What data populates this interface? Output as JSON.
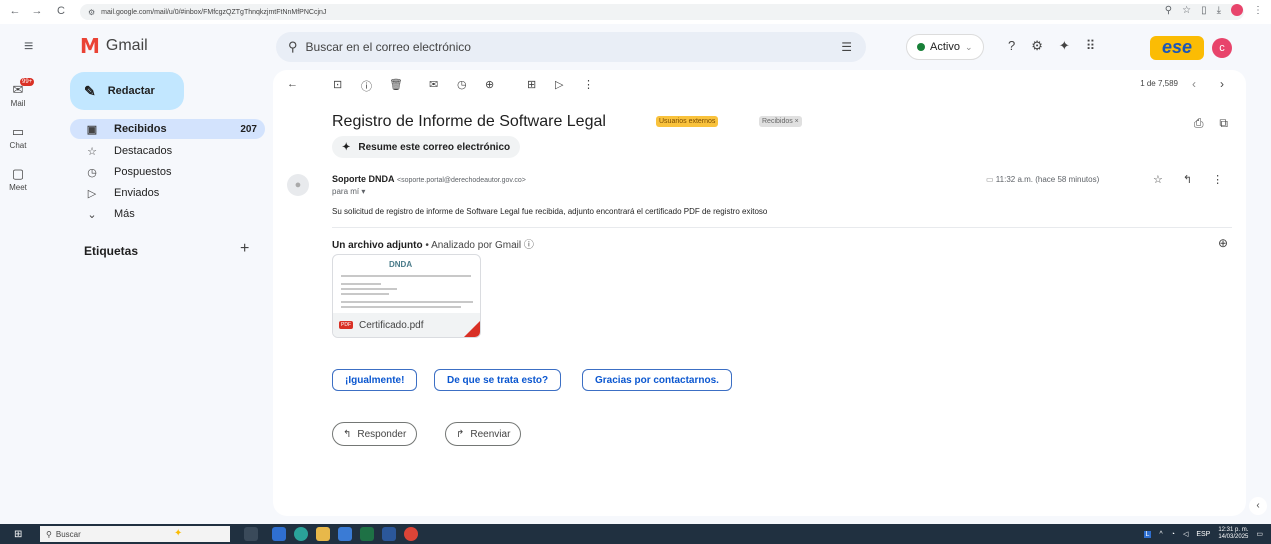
{
  "browser": {
    "url": "mail.google.com/mail/u/0/#inbox/FMfcgzQZTgThnqkzjmtFtNnMfPNCcjnJ",
    "nav": {
      "back": "←",
      "forward": "→",
      "reload": "C"
    },
    "right_icons": [
      "⚲",
      "☆",
      "▯",
      "⤓"
    ]
  },
  "header": {
    "app_name": "Gmail",
    "search_placeholder": "Buscar en el correo electrónico",
    "status_label": "Activo",
    "brand_text": "ese",
    "avatar_initial": "c"
  },
  "rail": {
    "badge": "99+",
    "items": [
      {
        "label": "Mail",
        "icon": "mail-icon"
      },
      {
        "label": "Chat",
        "icon": "chat-icon"
      },
      {
        "label": "Meet",
        "icon": "meet-icon"
      }
    ]
  },
  "sidebar": {
    "compose_label": "Redactar",
    "folders": [
      {
        "label": "Recibidos",
        "count": "207",
        "icon": "inbox-icon"
      },
      {
        "label": "Destacados",
        "count": "",
        "icon": "star-icon"
      },
      {
        "label": "Pospuestos",
        "count": "",
        "icon": "clock-icon"
      },
      {
        "label": "Enviados",
        "count": "",
        "icon": "send-icon"
      },
      {
        "label": "Más",
        "count": "",
        "icon": "chevron-down-icon"
      }
    ],
    "labels_heading": "Etiquetas"
  },
  "toolbar": {
    "pager_text": "1 de 7,589"
  },
  "message": {
    "subject": "Registro de Informe de Software Legal",
    "tag_external": "Usuarios externos",
    "tag_inbox": "Recibidos ×",
    "summarize_label": "Resume este correo electrónico",
    "sender_name": "Soporte DNDA",
    "sender_email": "<soporte.portal@derechodeautor.gov.co>",
    "to_me": "para mí ▾",
    "time": "11:32 a.m. (hace 58 minutos)",
    "body": "Su solicitud de registro de informe de Software Legal fue recibida, adjunto encontrará el certificado PDF de registro exitoso",
    "attachment_heading": "Un archivo adjunto",
    "attachment_scan": " • Analizado por Gmail ⓘ",
    "attachment_name": "Certificado.pdf",
    "attachment_logo": "DNDA"
  },
  "smart_replies": [
    "¡Igualmente!",
    "De que se trata esto?",
    "Gracias por contactarnos."
  ],
  "actions": {
    "reply": "Responder",
    "forward": "Reenviar"
  },
  "taskbar": {
    "search_label": "Buscar",
    "language": "ESP",
    "clock_time": "12:31 p. m.",
    "clock_date": "14/03/2025"
  },
  "colors": {
    "accent": "#0b57d0",
    "compose_bg": "#c2e7ff",
    "active_folder_bg": "#d3e3fd",
    "tag_external_bg": "#f9c23c",
    "status_green": "#188038"
  }
}
